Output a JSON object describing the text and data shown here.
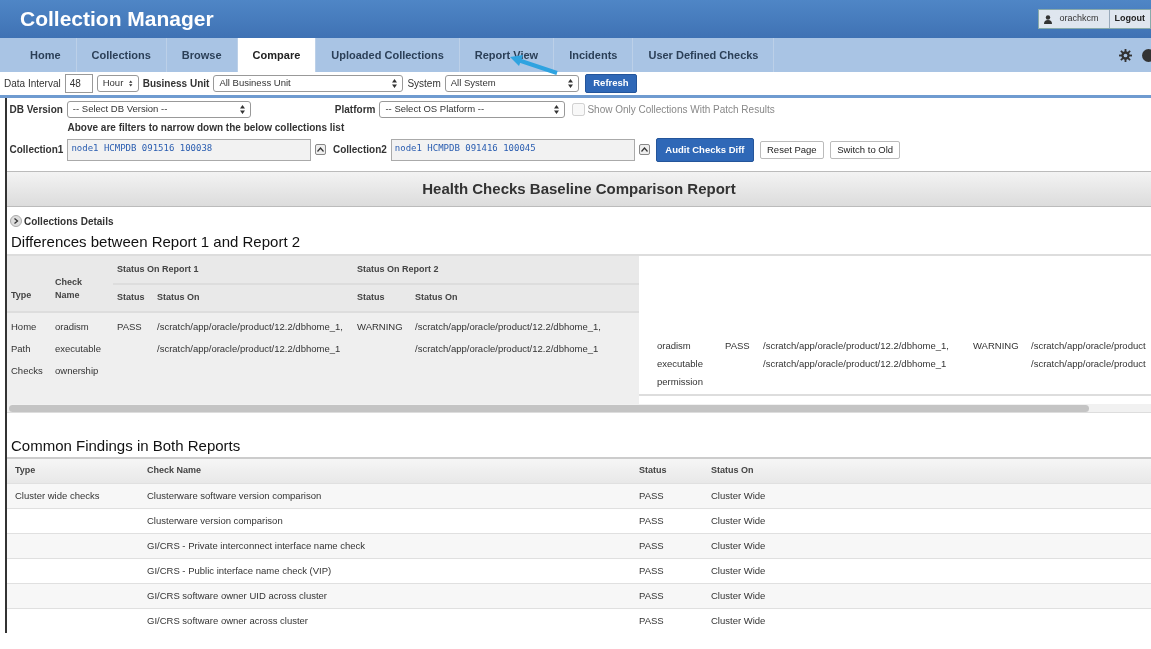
{
  "app_title": "Collection Manager",
  "user": {
    "name": "orachkcm",
    "logout": "Logout"
  },
  "tabs": [
    {
      "label": "Home",
      "selected": false
    },
    {
      "label": "Collections",
      "selected": false
    },
    {
      "label": "Browse",
      "selected": false
    },
    {
      "label": "Compare",
      "selected": true
    },
    {
      "label": "Uploaded Collections",
      "selected": false
    },
    {
      "label": "Report View",
      "selected": false
    },
    {
      "label": "Incidents",
      "selected": false
    },
    {
      "label": "User Defined Checks",
      "selected": false
    }
  ],
  "filters": {
    "interval_label": "Data Interval",
    "interval_value": "48",
    "interval_unit": "Hour",
    "business_unit_label": "Business Unit",
    "business_unit": "All Business Unit",
    "system_label": "System",
    "system": "All System",
    "refresh": "Refresh"
  },
  "selection": {
    "db_version_label": "DB Version",
    "db_version": "-- Select DB Version --",
    "platform_label": "Platform",
    "platform": "-- Select OS Platform --",
    "patch_only": {
      "label": "Show Only Collections With Patch Results",
      "checked": false,
      "disabled": true
    },
    "hint": "Above are filters to narrow down the below collections list",
    "collection1_label": "Collection1",
    "collection1": "node1 HCMPDB 091516 100038",
    "collection2_label": "Collection2",
    "collection2": "node1 HCMPDB 091416 100045",
    "buttons": [
      {
        "label": "Audit Checks Diff",
        "kind": "primary"
      },
      {
        "label": "Reset Page",
        "kind": "plain"
      },
      {
        "label": "Switch to Old",
        "kind": "plain"
      }
    ]
  },
  "report_title": "Health Checks Baseline Comparison Report",
  "collections_details": {
    "label": "Collections Details",
    "expanded": false
  },
  "differences": {
    "title": "Differences between Report 1 and Report 2",
    "group_headers": [
      "Status On Report 1",
      "Status On Report 2"
    ],
    "columns": [
      "Type",
      "Check Name",
      "Status",
      "Status On",
      "Status",
      "Status On"
    ],
    "rows": [
      {
        "type": "Home Path Checks",
        "check_name": "oradism executable ownership",
        "status_1": "PASS",
        "status_on_1": [
          "/scratch/app/oracle/product/12.2/dbhome_1,",
          "/scratch/app/oracle/product/12.2/dbhome_1"
        ],
        "status_2": "WARNING",
        "status_on_2": [
          "/scratch/app/oracle/product/12.2/dbhome_1,",
          "/scratch/app/oracle/product/12.2/dbhome_1"
        ]
      }
    ],
    "side_rows": [
      {
        "check_name": "oradism executable permission",
        "status_1": "PASS",
        "status_on_1": [
          "/scratch/app/oracle/product/12.2/dbhome_1,",
          "/scratch/app/oracle/product/12.2/dbhome_1"
        ],
        "status_2": "WARNING",
        "status_on_2": [
          "/scratch/app/oracle/product",
          "/scratch/app/oracle/product"
        ]
      }
    ]
  },
  "common": {
    "title": "Common Findings in Both Reports",
    "columns": [
      "Type",
      "Check Name",
      "Status",
      "Status On"
    ],
    "rows": [
      {
        "type": "Cluster wide checks",
        "check_name": "Clusterware software version comparison",
        "status": "PASS",
        "status_on": "Cluster Wide"
      },
      {
        "check_name": "Clusterware version comparison",
        "status": "PASS",
        "status_on": "Cluster Wide"
      },
      {
        "check_name": "GI/CRS - Private interconnect interface name check",
        "status": "PASS",
        "status_on": "Cluster Wide"
      },
      {
        "check_name": "GI/CRS - Public interface name check (VIP)",
        "status": "PASS",
        "status_on": "Cluster Wide"
      },
      {
        "check_name": "GI/CRS software owner UID across cluster",
        "status": "PASS",
        "status_on": "Cluster Wide"
      },
      {
        "check_name": "GI/CRS software owner across cluster",
        "status": "PASS",
        "status_on": "Cluster Wide"
      }
    ]
  }
}
